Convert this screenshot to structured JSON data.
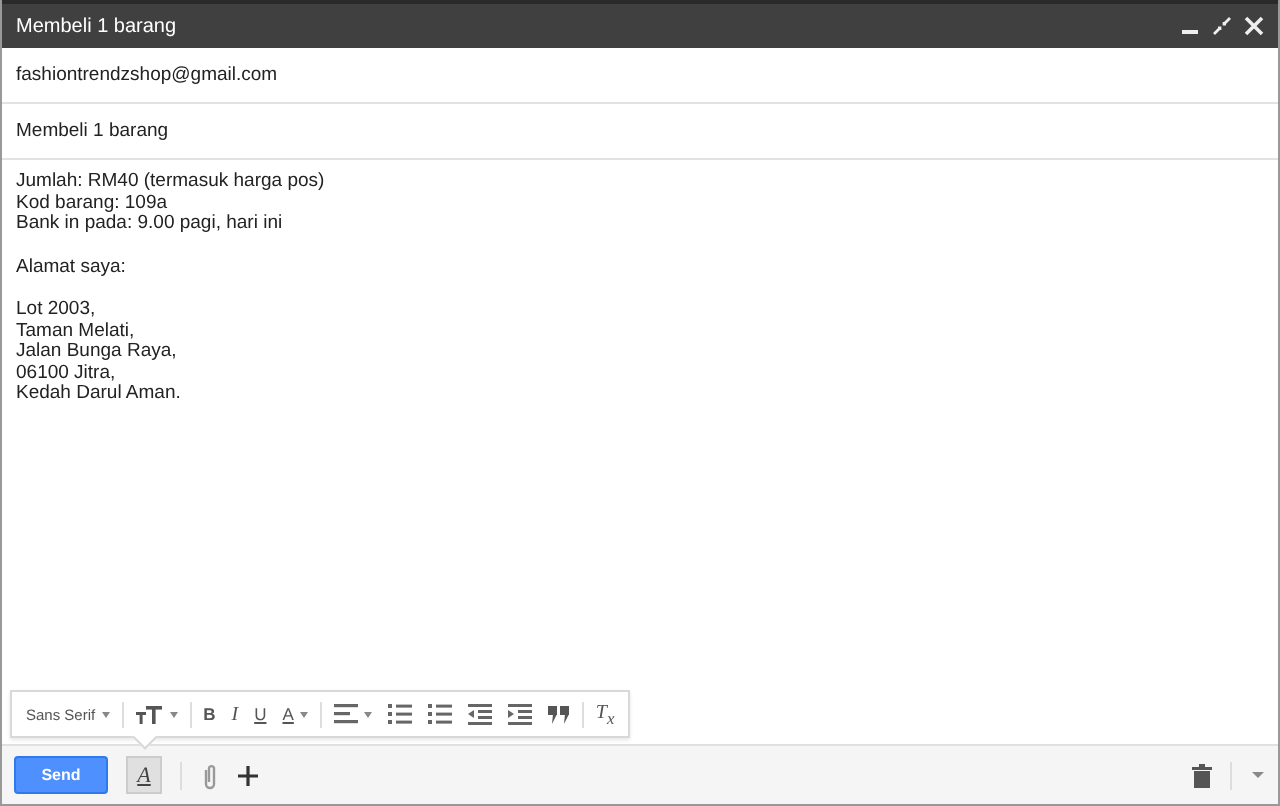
{
  "window": {
    "title": "Membeli 1 barang"
  },
  "recipient": "fashiontrendzshop@gmail.com",
  "subject": "Membeli 1 barang",
  "body": [
    [
      "Jumlah: RM40 (termasuk harga pos)",
      "Kod barang: 109a",
      "Bank in pada: 9.00 pagi, hari ini"
    ],
    [
      "Alamat saya:"
    ],
    [
      "Lot 2003,",
      "Taman Melati,",
      "Jalan Bunga Raya,",
      "06100 Jitra,",
      "Kedah Darul Aman."
    ]
  ],
  "formatting_toolbar": {
    "font": "Sans Serif",
    "tools": [
      {
        "kind": "size"
      },
      {
        "kind": "bold",
        "label": "B"
      },
      {
        "kind": "italic",
        "label": "I"
      },
      {
        "kind": "underline",
        "label": "U"
      },
      {
        "kind": "color",
        "label": "A"
      },
      {
        "kind": "align"
      },
      {
        "kind": "numbered"
      },
      {
        "kind": "bulleted"
      },
      {
        "kind": "outdent"
      },
      {
        "kind": "indent"
      },
      {
        "kind": "quote"
      },
      {
        "kind": "clear",
        "label": "T$_{x}$"
      }
    ]
  },
  "bottom_bar": {
    "send": "Send",
    "format_button": {
      "label": "A",
      "selected": true
    }
  }
}
